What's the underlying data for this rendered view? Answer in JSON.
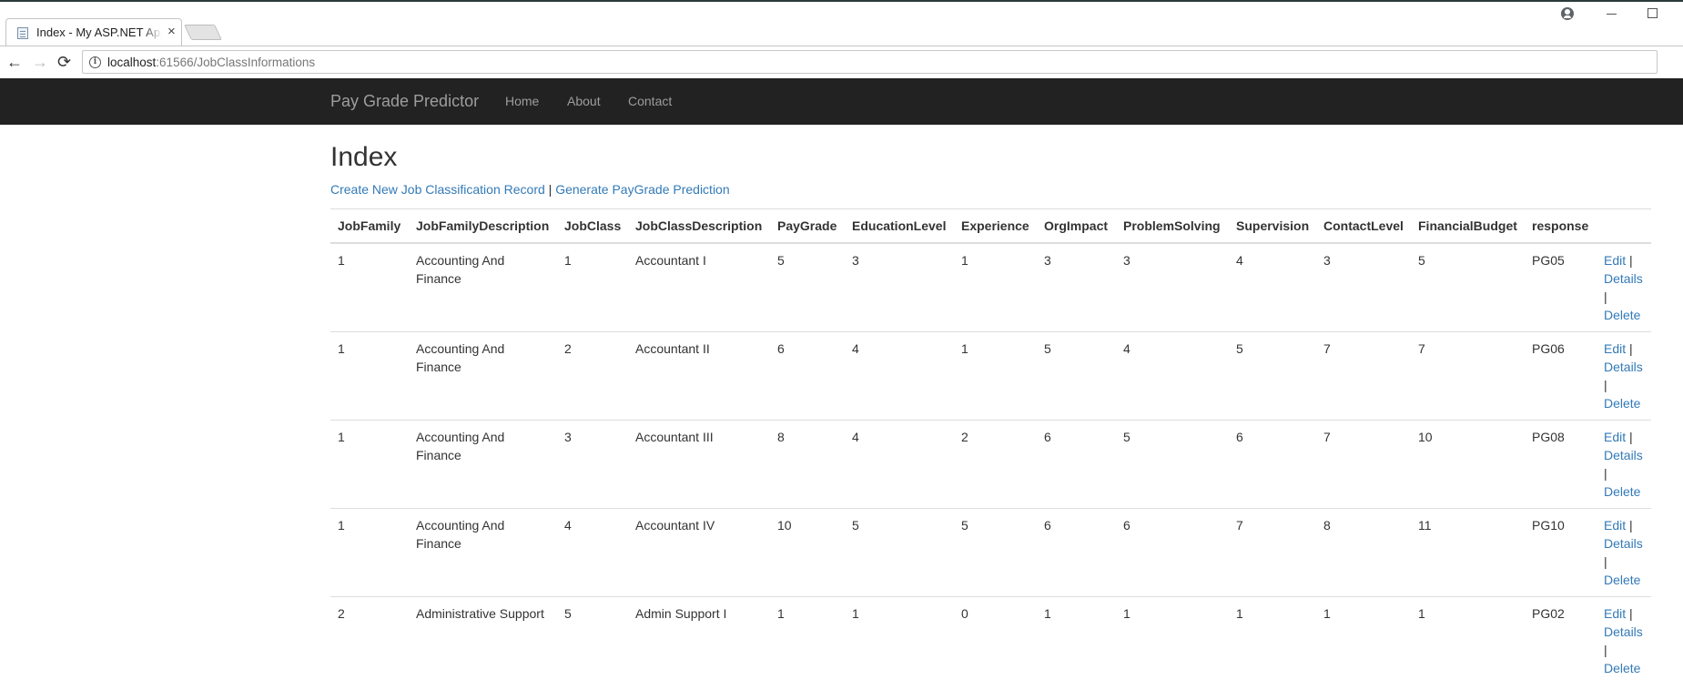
{
  "browser": {
    "tab_title": "Index - My ASP.NET Appl",
    "tab_close": "×",
    "url_host": "localhost",
    "url_rest": ":61566/JobClassInformations",
    "back_glyph": "←",
    "forward_glyph": "→",
    "reload_glyph": "⟳",
    "info_glyph": "i",
    "star_glyph": "☆"
  },
  "navbar": {
    "brand": "Pay Grade Predictor",
    "links": [
      "Home",
      "About",
      "Contact"
    ]
  },
  "page": {
    "title": "Index",
    "create_link": "Create New Job Classification Record",
    "separator": "|",
    "generate_link": "Generate PayGrade Prediction"
  },
  "table": {
    "columns": [
      "JobFamily",
      "JobFamilyDescription",
      "JobClass",
      "JobClassDescription",
      "PayGrade",
      "EducationLevel",
      "Experience",
      "OrgImpact",
      "ProblemSolving",
      "Supervision",
      "ContactLevel",
      "FinancialBudget",
      "response",
      ""
    ],
    "rows": [
      [
        "1",
        "Accounting And Finance",
        "1",
        "Accountant I",
        "5",
        "3",
        "1",
        "3",
        "3",
        "4",
        "3",
        "5",
        "PG05"
      ],
      [
        "1",
        "Accounting And Finance",
        "2",
        "Accountant II",
        "6",
        "4",
        "1",
        "5",
        "4",
        "5",
        "7",
        "7",
        "PG06"
      ],
      [
        "1",
        "Accounting And Finance",
        "3",
        "Accountant III",
        "8",
        "4",
        "2",
        "6",
        "5",
        "6",
        "7",
        "10",
        "PG08"
      ],
      [
        "1",
        "Accounting And Finance",
        "4",
        "Accountant IV",
        "10",
        "5",
        "5",
        "6",
        "6",
        "7",
        "8",
        "11",
        "PG10"
      ],
      [
        "2",
        "Administrative Support",
        "5",
        "Admin Support I",
        "1",
        "1",
        "0",
        "1",
        "1",
        "1",
        "1",
        "1",
        "PG02"
      ]
    ],
    "row_actions": {
      "edit": "Edit",
      "details": "Details",
      "delete": "Delete",
      "separator": "|"
    }
  },
  "colors": {
    "navbar_bg": "#222222",
    "navbar_text": "#9d9d9d",
    "link": "#337ab7",
    "text": "#333333",
    "border": "#dddddd"
  }
}
